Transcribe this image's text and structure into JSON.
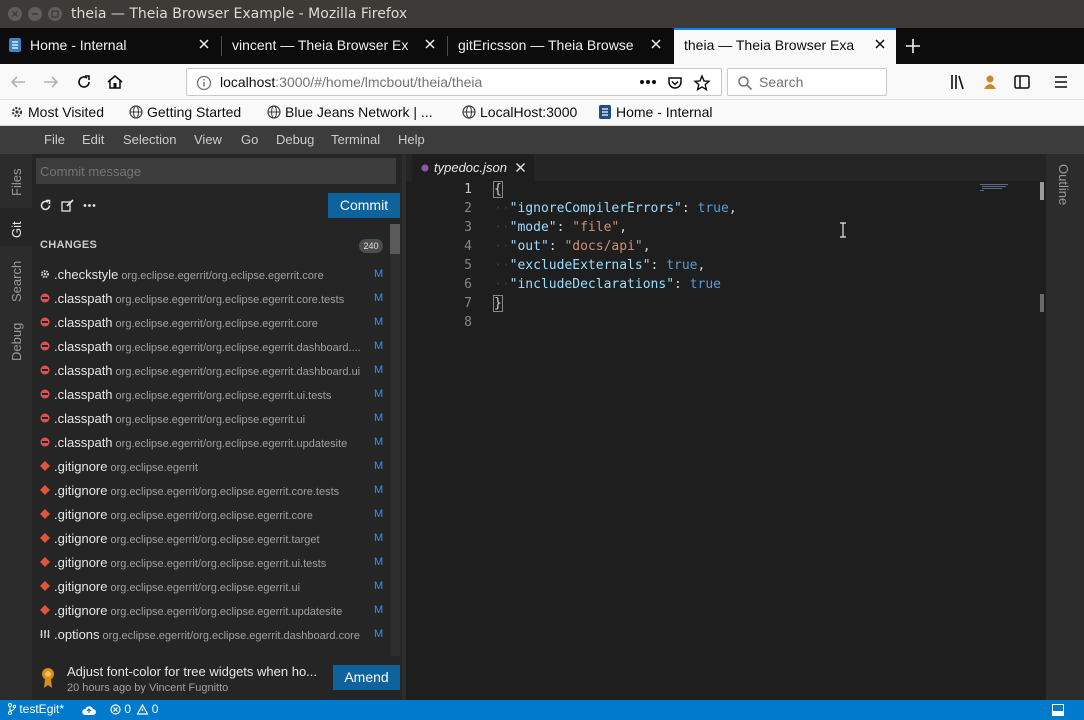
{
  "window": {
    "title": "theia — Theia Browser Example - Mozilla Firefox"
  },
  "browser_tabs": [
    {
      "label": "Home - Internal"
    },
    {
      "label": "vincent — Theia Browser Ex"
    },
    {
      "label": "gitEricsson — Theia Browse"
    },
    {
      "label": "theia — Theia Browser Exa"
    }
  ],
  "navbar": {
    "url_host": "localhost",
    "url_rest": ":3000/#/home/lmcbout/theia/theia",
    "search_placeholder": "Search"
  },
  "bookmarks": [
    {
      "label": "Most Visited",
      "icon": "gear-icon"
    },
    {
      "label": "Getting Started",
      "icon": "globe-icon"
    },
    {
      "label": "Blue Jeans Network | ...",
      "icon": "globe-icon"
    },
    {
      "label": "LocalHost:3000",
      "icon": "globe-icon"
    },
    {
      "label": "Home - Internal",
      "icon": "page-icon"
    }
  ],
  "app_menu": [
    "File",
    "Edit",
    "Selection",
    "View",
    "Go",
    "Debug",
    "Terminal",
    "Help"
  ],
  "left_tabs": [
    "Files",
    "Git",
    "Search",
    "Debug"
  ],
  "right_tabs": [
    "Outline"
  ],
  "git": {
    "commit_placeholder": "Commit message",
    "commit_label": "Commit",
    "changes_header": "CHANGES",
    "changes_count": "240",
    "changes": [
      {
        "name": ".checkstyle",
        "path": "org.eclipse.egerrit/org.eclipse.egerrit.core",
        "status": "M",
        "icon": "gear-icon",
        "color": "#cccccc"
      },
      {
        "name": ".classpath",
        "path": "org.eclipse.egerrit/org.eclipse.egerrit.core.tests",
        "status": "M",
        "icon": "classpath-icon",
        "color": "#e05252"
      },
      {
        "name": ".classpath",
        "path": "org.eclipse.egerrit/org.eclipse.egerrit.core",
        "status": "M",
        "icon": "classpath-icon",
        "color": "#e05252"
      },
      {
        "name": ".classpath",
        "path": "org.eclipse.egerrit/org.eclipse.egerrit.dashboard....",
        "status": "M",
        "icon": "classpath-icon",
        "color": "#e05252"
      },
      {
        "name": ".classpath",
        "path": "org.eclipse.egerrit/org.eclipse.egerrit.dashboard.ui",
        "status": "M",
        "icon": "classpath-icon",
        "color": "#e05252"
      },
      {
        "name": ".classpath",
        "path": "org.eclipse.egerrit/org.eclipse.egerrit.ui.tests",
        "status": "M",
        "icon": "classpath-icon",
        "color": "#e05252"
      },
      {
        "name": ".classpath",
        "path": "org.eclipse.egerrit/org.eclipse.egerrit.ui",
        "status": "M",
        "icon": "classpath-icon",
        "color": "#e05252"
      },
      {
        "name": ".classpath",
        "path": "org.eclipse.egerrit/org.eclipse.egerrit.updatesite",
        "status": "M",
        "icon": "classpath-icon",
        "color": "#e05252"
      },
      {
        "name": ".gitignore",
        "path": "org.eclipse.egerrit",
        "status": "M",
        "icon": "git-icon",
        "color": "#e0553a"
      },
      {
        "name": ".gitignore",
        "path": "org.eclipse.egerrit/org.eclipse.egerrit.core.tests",
        "status": "M",
        "icon": "git-icon",
        "color": "#e0553a"
      },
      {
        "name": ".gitignore",
        "path": "org.eclipse.egerrit/org.eclipse.egerrit.core",
        "status": "M",
        "icon": "git-icon",
        "color": "#e0553a"
      },
      {
        "name": ".gitignore",
        "path": "org.eclipse.egerrit/org.eclipse.egerrit.target",
        "status": "M",
        "icon": "git-icon",
        "color": "#e0553a"
      },
      {
        "name": ".gitignore",
        "path": "org.eclipse.egerrit/org.eclipse.egerrit.ui.tests",
        "status": "M",
        "icon": "git-icon",
        "color": "#e0553a"
      },
      {
        "name": ".gitignore",
        "path": "org.eclipse.egerrit/org.eclipse.egerrit.ui",
        "status": "M",
        "icon": "git-icon",
        "color": "#e0553a"
      },
      {
        "name": ".gitignore",
        "path": "org.eclipse.egerrit/org.eclipse.egerrit.updatesite",
        "status": "M",
        "icon": "git-icon",
        "color": "#e0553a"
      },
      {
        "name": ".options",
        "path": "org.eclipse.egerrit/org.eclipse.egerrit.dashboard.core",
        "status": "M",
        "icon": "options-icon",
        "color": "#cccccc"
      }
    ],
    "last_commit": {
      "message": "Adjust font-color for tree widgets when ho...",
      "meta": "20 hours ago by Vincent Fugnitto"
    },
    "amend_label": "Amend"
  },
  "editor": {
    "tab_label": "typedoc.json",
    "lines": [
      {
        "n": "1",
        "html": "<span>{</span>"
      },
      {
        "n": "2",
        "parts": [
          [
            "ws",
            "··"
          ],
          [
            "key",
            "\"ignoreCompilerErrors\""
          ],
          [
            "p",
            ": "
          ],
          [
            "bool",
            "true"
          ],
          [
            "p",
            ","
          ]
        ]
      },
      {
        "n": "3",
        "parts": [
          [
            "ws",
            "··"
          ],
          [
            "key",
            "\"mode\""
          ],
          [
            "p",
            ": "
          ],
          [
            "str",
            "\"file\""
          ],
          [
            "p",
            ","
          ]
        ]
      },
      {
        "n": "4",
        "parts": [
          [
            "ws",
            "··"
          ],
          [
            "key",
            "\"out\""
          ],
          [
            "p",
            ": "
          ],
          [
            "str",
            "\"docs/api\""
          ],
          [
            "p",
            ","
          ]
        ]
      },
      {
        "n": "5",
        "parts": [
          [
            "ws",
            "··"
          ],
          [
            "key",
            "\"excludeExternals\""
          ],
          [
            "p",
            ": "
          ],
          [
            "bool",
            "true"
          ],
          [
            "p",
            ","
          ]
        ]
      },
      {
        "n": "6",
        "parts": [
          [
            "ws",
            "··"
          ],
          [
            "key",
            "\"includeDeclarations\""
          ],
          [
            "p",
            ": "
          ],
          [
            "bool",
            "true"
          ]
        ]
      },
      {
        "n": "7",
        "parts": [
          [
            "p",
            "}"
          ]
        ]
      },
      {
        "n": "8",
        "parts": []
      }
    ]
  },
  "statusbar": {
    "branch": "testEgit*",
    "errors": "0",
    "warnings": "0"
  },
  "colors": {
    "accent": "#007acc",
    "button": "#0e639c",
    "firefox_blue": "#0a84ff"
  }
}
